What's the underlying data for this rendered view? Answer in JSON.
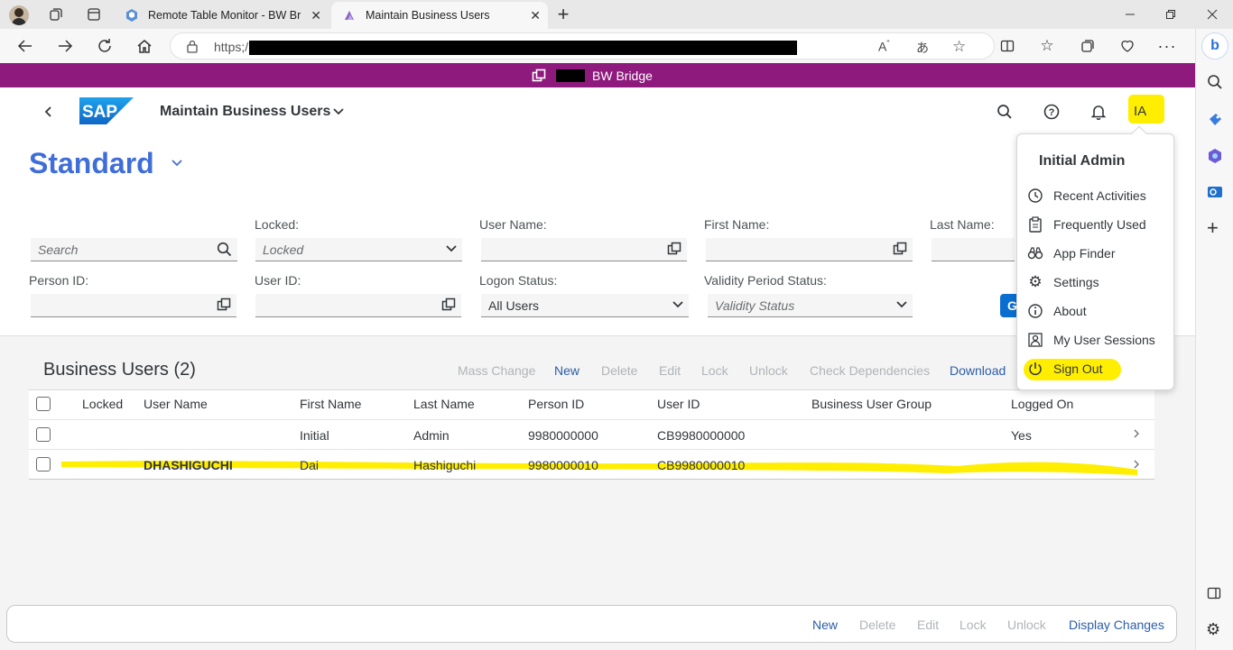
{
  "browser": {
    "tabs": [
      {
        "title": "Remote Table Monitor - BW Brid",
        "icon": "sap-ui-icon",
        "active": false
      },
      {
        "title": "Maintain Business Users",
        "icon": "sap-app-icon",
        "active": true
      }
    ],
    "url_prefix": "https;/",
    "window_controls": [
      "minimize",
      "restore",
      "close"
    ]
  },
  "shell": {
    "system_name": "BW Bridge",
    "app_title": "Maintain Business Users",
    "avatar_initials": "IA"
  },
  "page": {
    "variant": "Standard",
    "filters": {
      "search_placeholder": "Search",
      "locked_label": "Locked:",
      "locked_value": "Locked",
      "user_name_label": "User Name:",
      "first_name_label": "First Name:",
      "last_name_label": "Last Name:",
      "person_id_label": "Person ID:",
      "user_id_label": "User ID:",
      "logon_status_label": "Logon Status:",
      "logon_status_value": "All Users",
      "validity_label": "Validity Period Status:",
      "validity_value": "Validity Status",
      "go_button": "G"
    }
  },
  "table": {
    "title": "Business Users (2)",
    "toolbar": [
      "Mass Change",
      "New",
      "Delete",
      "Edit",
      "Lock",
      "Unlock",
      "Check Dependencies",
      "Download"
    ],
    "toolbar_enabled": [
      "New",
      "Download"
    ],
    "columns": [
      "Locked",
      "User Name",
      "First Name",
      "Last Name",
      "Person ID",
      "User ID",
      "Business User Group",
      "Logged On"
    ],
    "rows": [
      {
        "locked": "",
        "user_name": "",
        "first_name": "Initial",
        "last_name": "Admin",
        "person_id": "9980000000",
        "user_id": "CB9980000000",
        "group": "",
        "logged_on": "Yes"
      },
      {
        "locked": "",
        "user_name": "DHASHIGUCHI",
        "first_name": "Dai",
        "last_name": "Hashiguchi",
        "person_id": "9980000010",
        "user_id": "CB9980000010",
        "group": "",
        "logged_on": ""
      }
    ]
  },
  "footer": {
    "buttons": [
      "New",
      "Delete",
      "Edit",
      "Lock",
      "Unlock",
      "Display Changes"
    ],
    "enabled": [
      "New",
      "Display Changes"
    ]
  },
  "user_menu": {
    "name": "Initial Admin",
    "items": [
      {
        "label": "Recent Activities",
        "icon": "history-icon"
      },
      {
        "label": "Frequently Used",
        "icon": "clipboard-icon"
      },
      {
        "label": "App Finder",
        "icon": "binoculars-icon"
      },
      {
        "label": "Settings",
        "icon": "gear-icon"
      },
      {
        "label": "About",
        "icon": "info-icon"
      },
      {
        "label": "My User Sessions",
        "icon": "user-sessions-icon"
      },
      {
        "label": "Sign Out",
        "icon": "power-icon"
      }
    ]
  },
  "colors": {
    "shell_bar": "#8e1a7d",
    "variant_title": "#3f6ed9",
    "link": "#2c5ea8",
    "highlight": "#ffee00"
  }
}
